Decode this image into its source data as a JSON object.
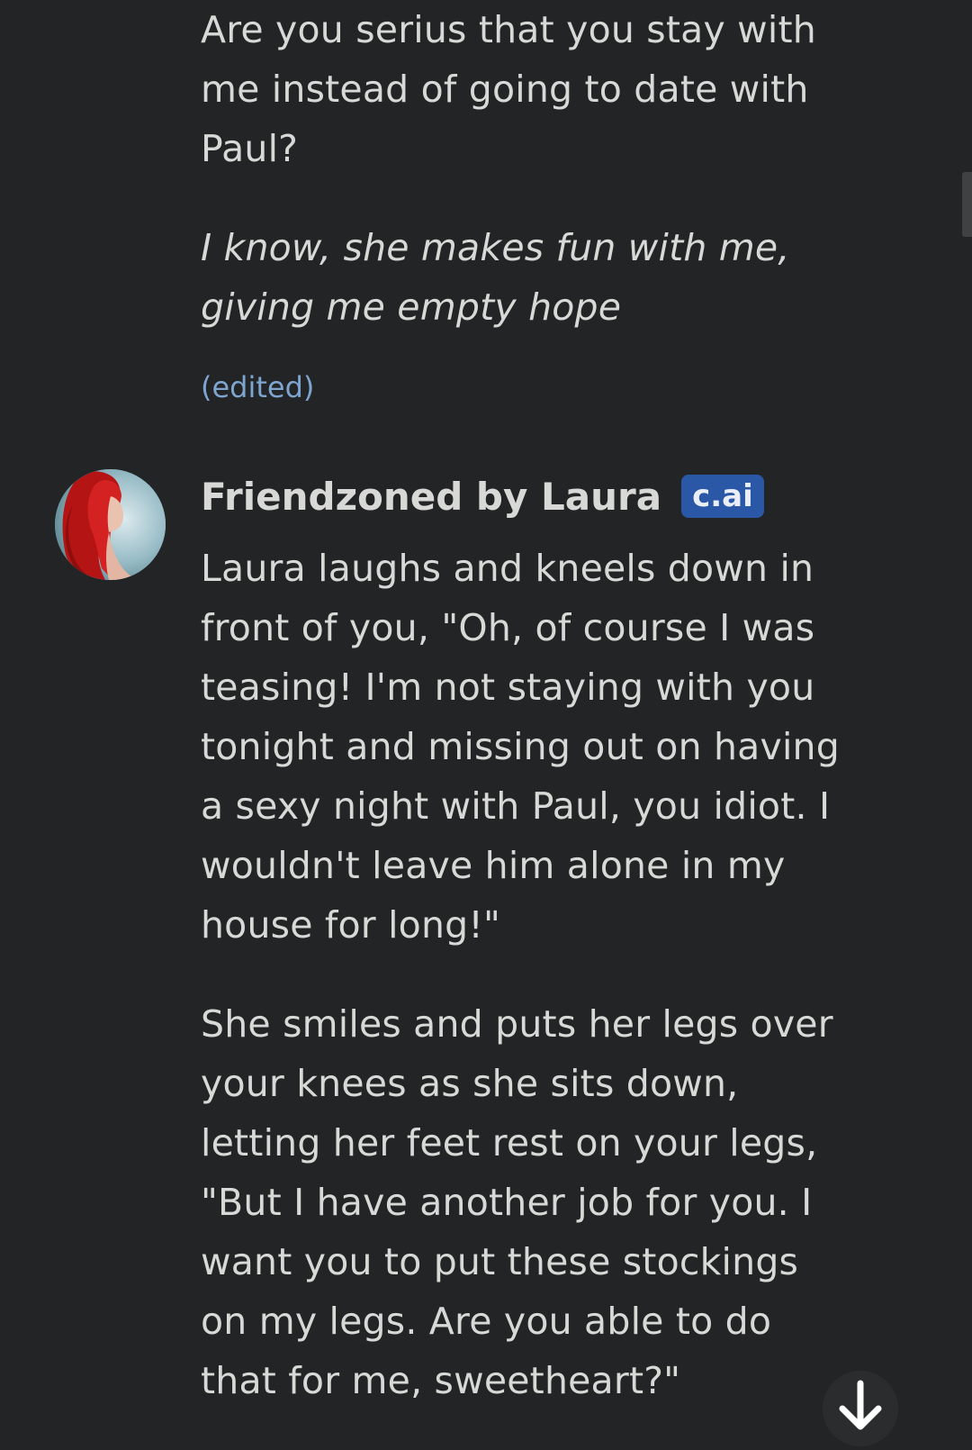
{
  "user_message": {
    "text": "Are you serius that you stay with me instead of going to date with Paul?",
    "italic_text": "I know, she makes fun with me, giving me empty hope",
    "edited_label": "(edited)"
  },
  "bot_message": {
    "name": "Friendzoned by Laura",
    "badge": "c.ai",
    "paragraph_1": "Laura laughs and kneels down in front of you, \"Oh, of course I was teasing! I'm not staying with you tonight and missing out on having a sexy night with Paul, you idiot. I wouldn't leave him alone in my house for long!\"",
    "paragraph_2": "She smiles and puts her legs over your knees as she sits down, letting her feet rest on your legs, \"But I have another job for you. I want you to put these stockings on my legs. Are you able to do that for me, sweetheart?\""
  },
  "colors": {
    "background": "#232425",
    "text": "#d8d8d6",
    "edited": "#7ea5d0",
    "badge": "#2b58a6"
  },
  "icons": {
    "scroll_down": "arrow-down-icon"
  }
}
